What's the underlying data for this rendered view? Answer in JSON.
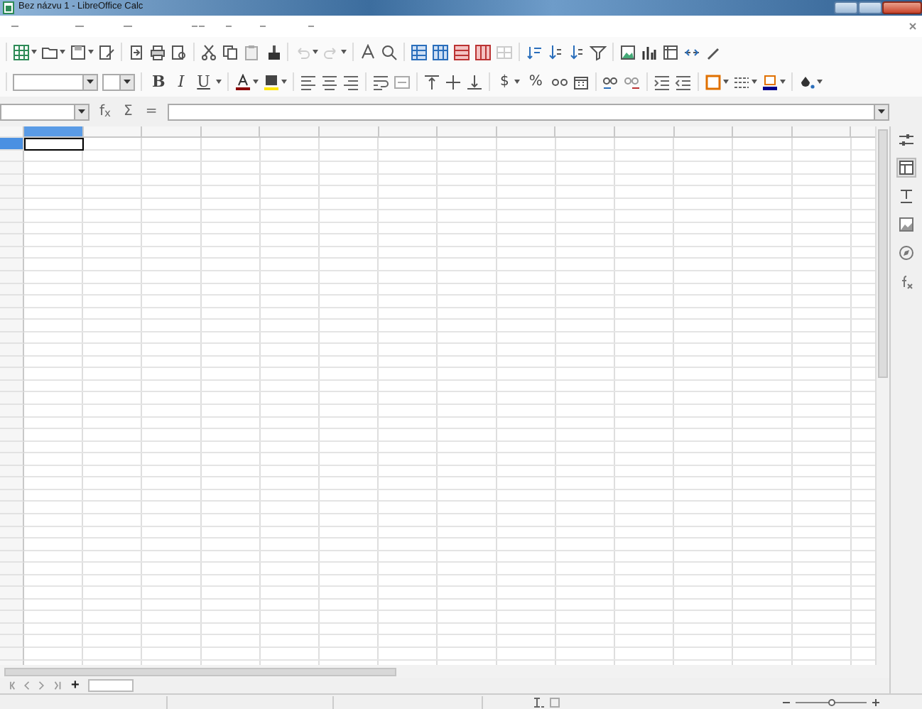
{
  "window": {
    "title": "Bez názvu 1 - LibreOffice Calc"
  },
  "format_toolbar": {
    "style_buttons": [
      {
        "label": "B",
        "kind": "bold"
      },
      {
        "label": "I",
        "kind": "italic"
      },
      {
        "label": "U",
        "kind": "underline"
      }
    ],
    "number_buttons": [
      {
        "label": "$"
      },
      {
        "label": "%"
      }
    ]
  },
  "formula_bar": {
    "buttons": [
      {
        "label": "f$_{x}$"
      },
      {
        "label": "Σ"
      },
      {
        "label": "="
      }
    ]
  },
  "grid": {
    "columns": [
      {
        "selected": true
      },
      {
        "selected": false
      },
      {
        "selected": false
      },
      {
        "selected": false
      },
      {
        "selected": false
      },
      {
        "selected": false
      },
      {
        "selected": false
      },
      {
        "selected": false
      },
      {
        "selected": false
      },
      {
        "selected": false
      },
      {
        "selected": false
      },
      {
        "selected": false
      },
      {
        "selected": false
      },
      {
        "selected": false
      },
      {
        "selected": false
      }
    ],
    "rows": [
      {
        "selected": true
      },
      {
        "selected": false
      },
      {
        "selected": false
      },
      {
        "selected": false
      },
      {
        "selected": false
      },
      {
        "selected": false
      },
      {
        "selected": false
      },
      {
        "selected": false
      },
      {
        "selected": false
      },
      {
        "selected": false
      },
      {
        "selected": false
      },
      {
        "selected": false
      },
      {
        "selected": false
      },
      {
        "selected": false
      },
      {
        "selected": false
      },
      {
        "selected": false
      },
      {
        "selected": false
      },
      {
        "selected": false
      },
      {
        "selected": false
      },
      {
        "selected": false
      },
      {
        "selected": false
      },
      {
        "selected": false
      },
      {
        "selected": false
      },
      {
        "selected": false
      },
      {
        "selected": false
      },
      {
        "selected": false
      },
      {
        "selected": false
      },
      {
        "selected": false
      },
      {
        "selected": false
      },
      {
        "selected": false
      },
      {
        "selected": false
      },
      {
        "selected": false
      },
      {
        "selected": false
      },
      {
        "selected": false
      },
      {
        "selected": false
      },
      {
        "selected": false
      },
      {
        "selected": false
      },
      {
        "selected": false
      },
      {
        "selected": false
      },
      {
        "selected": false
      },
      {
        "selected": false
      },
      {
        "selected": false
      },
      {
        "selected": false
      },
      {
        "selected": false
      }
    ]
  },
  "sheet_tabs": {
    "add_button": "+",
    "tabs": [
      {
        "selected": true
      }
    ]
  },
  "sidebar": {
    "tabs": [
      {
        "selected": true
      },
      {
        "selected": false
      },
      {
        "selected": false
      },
      {
        "selected": false
      },
      {
        "selected": false
      }
    ]
  },
  "status_bar": {
    "zoom": {
      "level": 0.5
    }
  }
}
